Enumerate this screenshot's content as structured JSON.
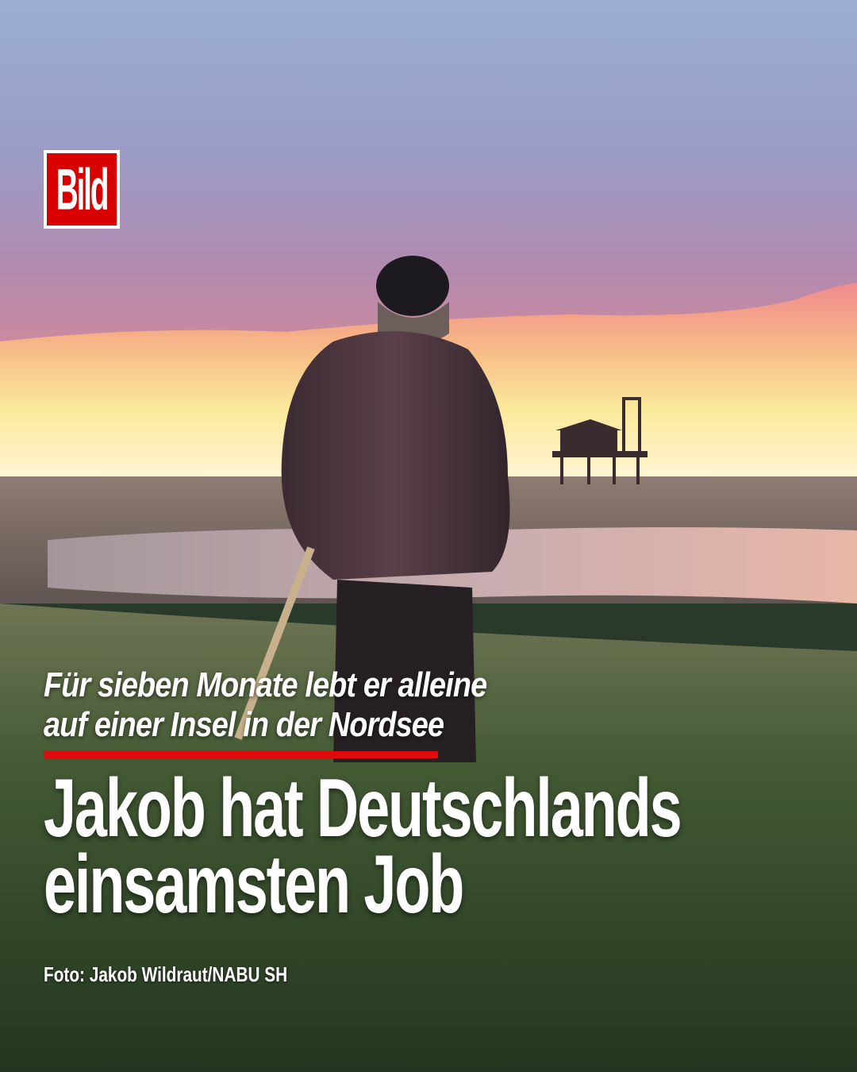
{
  "brand": {
    "logo_text": "Bild",
    "logo_color": "#d90000"
  },
  "post": {
    "kicker_lines": [
      "Für sieben Monate lebt er alleine",
      "auf einer Insel in der Nordsee"
    ],
    "headline_lines": [
      "Jakob hat Deutschlands",
      "einsamsten Job"
    ],
    "photo_credit": "Foto: Jakob Wildraut/NABU SH",
    "accent_color": "#e10a0a"
  }
}
